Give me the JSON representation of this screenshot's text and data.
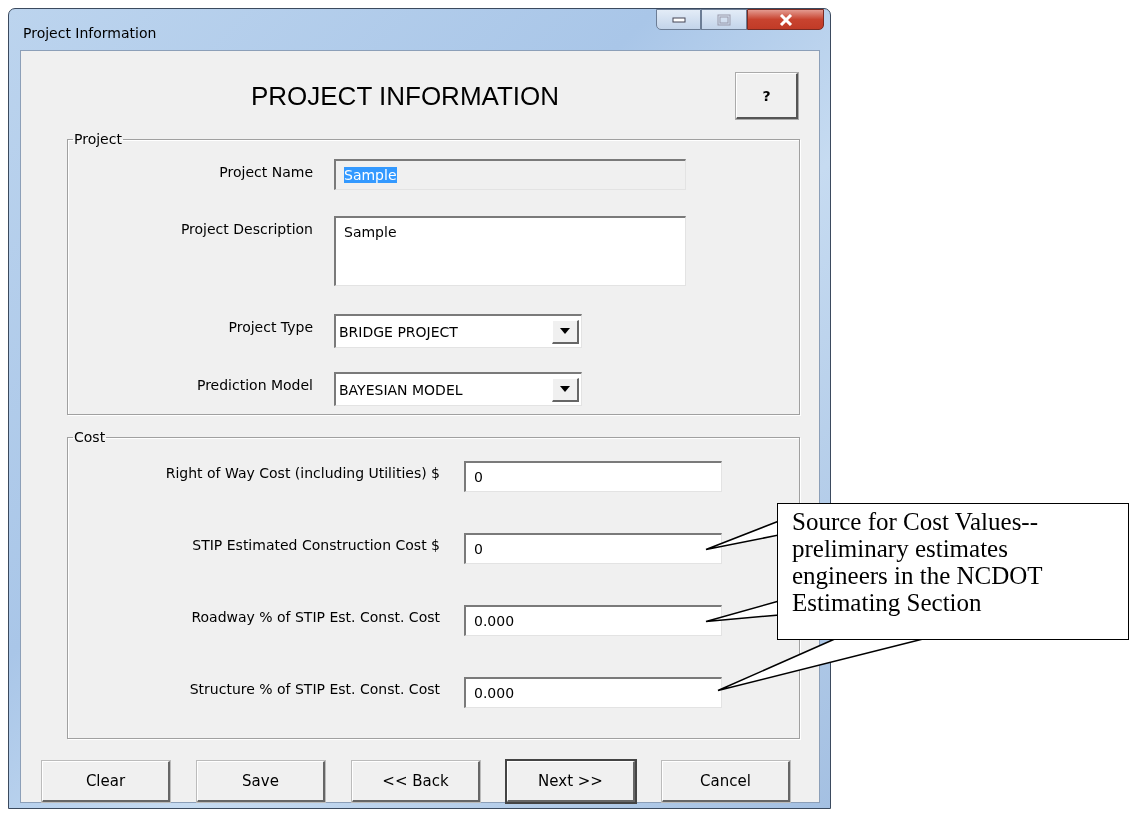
{
  "window": {
    "title": "Project Information"
  },
  "heading": "PROJECT INFORMATION",
  "help_button": "?",
  "project_group": {
    "legend": "Project",
    "fields": [
      {
        "kind": "text",
        "label": "Project Name",
        "value": "Sample",
        "disabled": true,
        "text_selected": true
      },
      {
        "kind": "textarea",
        "label": "Project Description",
        "value": "Sample",
        "disabled": false,
        "text_selected": false
      },
      {
        "kind": "dropdown",
        "label": "Project Type",
        "value": "BRIDGE PROJECT",
        "disabled": false,
        "text_selected": false
      },
      {
        "kind": "dropdown",
        "label": "Prediction Model",
        "value": "BAYESIAN MODEL",
        "disabled": false,
        "text_selected": false
      }
    ]
  },
  "cost_group": {
    "legend": "Cost",
    "fields": [
      {
        "label": "Right of Way Cost (including Utilities) $",
        "value": "0",
        "callout_pointer": false
      },
      {
        "label": "STIP Estimated Construction Cost $",
        "value": "0",
        "callout_pointer": true
      },
      {
        "label": "Roadway % of STIP Est. Const. Cost",
        "value": "0.000",
        "callout_pointer": true
      },
      {
        "label": "Structure % of STIP Est. Const. Cost",
        "value": "0.000",
        "callout_pointer": true
      }
    ]
  },
  "buttons": [
    {
      "label": "Clear",
      "default": false
    },
    {
      "label": "Save",
      "default": false
    },
    {
      "label": "<< Back",
      "default": false
    },
    {
      "label": "Next >>",
      "default": true
    },
    {
      "label": "Cancel",
      "default": false
    }
  ],
  "callout": {
    "text": "Source for Cost Values--preliminary estimates engineers in the NCDOT Estimating Section"
  }
}
